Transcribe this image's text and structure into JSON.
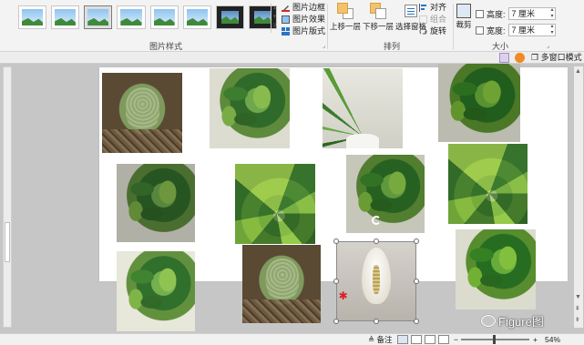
{
  "ribbon": {
    "picture_styles_label": "图片样式",
    "picture_border": "图片边框",
    "picture_effects": "图片效果",
    "picture_layout": "图片版式",
    "arrange_label": "排列",
    "bring_forward": "上移一层",
    "send_backward": "下移一层",
    "selection_pane": "选择窗格",
    "align": "对齐",
    "group": "组合",
    "rotate": "旋转",
    "crop": "裁剪",
    "size_label": "大小",
    "height_label": "高度:",
    "height_value": "7 厘米",
    "width_label": "宽度:",
    "width_value": "7 厘米"
  },
  "toolbar2": {
    "multi_window": "多窗口模式"
  },
  "status": {
    "notes": "备注",
    "zoom": "54%"
  },
  "watermark": "Figure图",
  "icons": {
    "border": "pen-icon",
    "effects": "effects-icon",
    "layout": "layout-icon",
    "align": "align-icon",
    "group": "group-icon",
    "rotate": "rotate-icon",
    "crop": "crop-icon",
    "rotate_handle": "rotate-handle-icon"
  },
  "colors": {
    "accent": "#2a74c4",
    "ribbon_bg": "#f3f3f3",
    "canvas_bg": "#c6c6c6"
  }
}
